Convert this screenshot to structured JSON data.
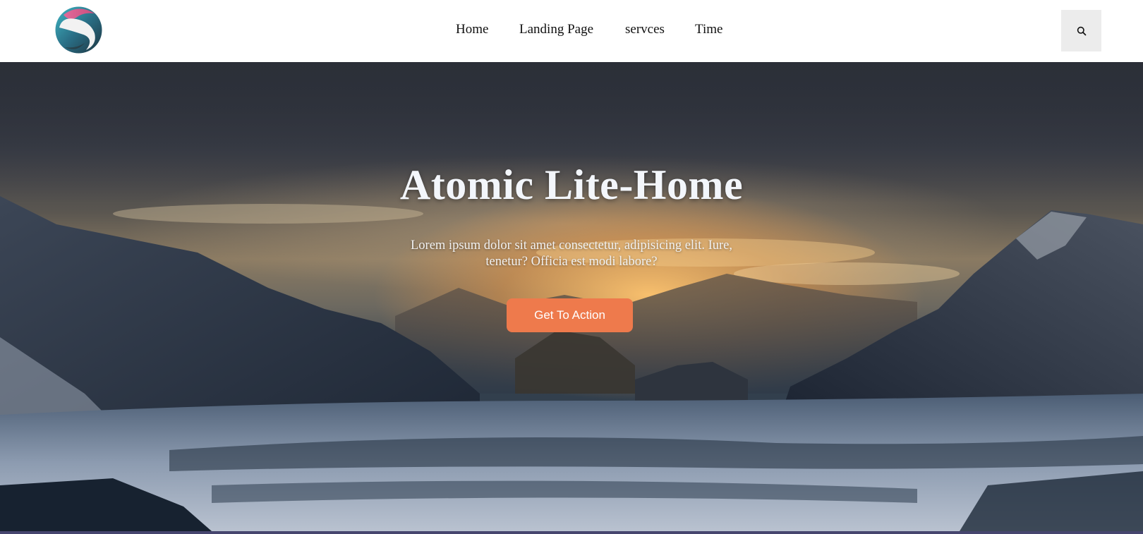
{
  "header": {
    "logo_icon": "s-sphere-logo-icon",
    "nav": [
      {
        "label": "Home"
      },
      {
        "label": "Landing Page"
      },
      {
        "label": "servces"
      },
      {
        "label": "Time"
      }
    ],
    "search_icon": "search-icon"
  },
  "hero": {
    "title": "Atomic Lite-Home",
    "text": "Lorem ipsum dolor sit amet consectetur, adipisicing elit. Iure, tenetur? Officia est modi labore?",
    "cta_label": "Get To Action"
  },
  "colors": {
    "cta": "#ee7a4c",
    "bottom_strip": "#46456e",
    "search_bg": "#ececec"
  }
}
